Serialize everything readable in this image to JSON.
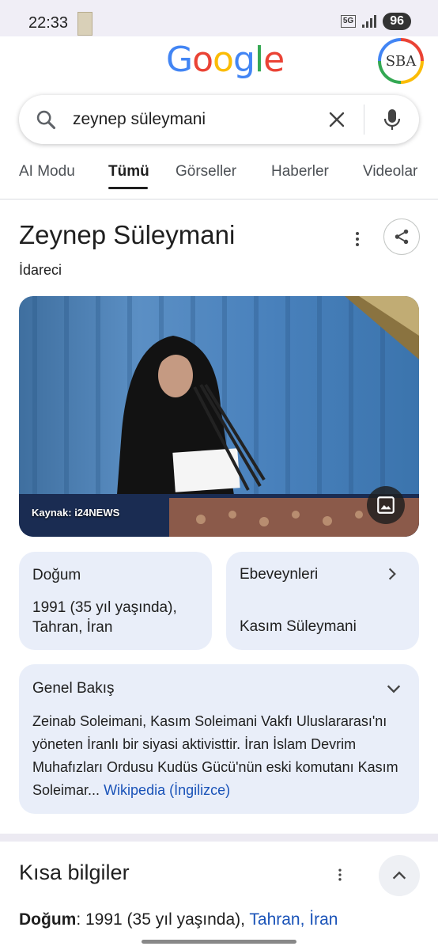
{
  "status_bar": {
    "time": "22:33",
    "network": "5G",
    "battery": "96"
  },
  "header": {
    "logo_letters": [
      {
        "ch": "G",
        "color": "#4285f4"
      },
      {
        "ch": "o",
        "color": "#ea4335"
      },
      {
        "ch": "o",
        "color": "#fbbc05"
      },
      {
        "ch": "g",
        "color": "#4285f4"
      },
      {
        "ch": "l",
        "color": "#34a853"
      },
      {
        "ch": "e",
        "color": "#ea4335"
      }
    ],
    "avatar_text": "SBA"
  },
  "search": {
    "query": "zeynep süleymani"
  },
  "tabs": [
    {
      "label": "AI Modu",
      "active": false
    },
    {
      "label": "Tümü",
      "active": true
    },
    {
      "label": "Görseller",
      "active": false
    },
    {
      "label": "Haberler",
      "active": false
    },
    {
      "label": "Videolar",
      "active": false
    }
  ],
  "knowledge_panel": {
    "title": "Zeynep Süleymani",
    "subtitle": "İdareci",
    "image_caption": "Kaynak: i24NEWS",
    "birth": {
      "label": "Doğum",
      "value_line1": "1991 (35 yıl yaşında),",
      "value_line2": "Tahran, İran"
    },
    "parents": {
      "label": "Ebeveynleri",
      "value": "Kasım Süleymani"
    },
    "overview": {
      "label": "Genel Bakış",
      "text": "Zeinab Soleimani, Kasım Soleimani Vakfı Uluslararası'nı yöneten İranlı bir siyasi aktivisttir. İran İslam Devrim Muhafızları Ordusu Kudüs Gücü'nün eski komutanı Kasım Soleimar",
      "ellipsis": "...",
      "link": "Wikipedia (İngilizce)"
    }
  },
  "quick_facts": {
    "title": "Kısa bilgiler",
    "birth_label": "Doğum",
    "birth_value": ": 1991 (35 yıl yaşında), ",
    "birth_link": "Tahran, İran"
  },
  "colors": {
    "accent_blue": "#1a53b8",
    "card_bg": "#e9eef9",
    "status_bg": "#f0eef6"
  }
}
